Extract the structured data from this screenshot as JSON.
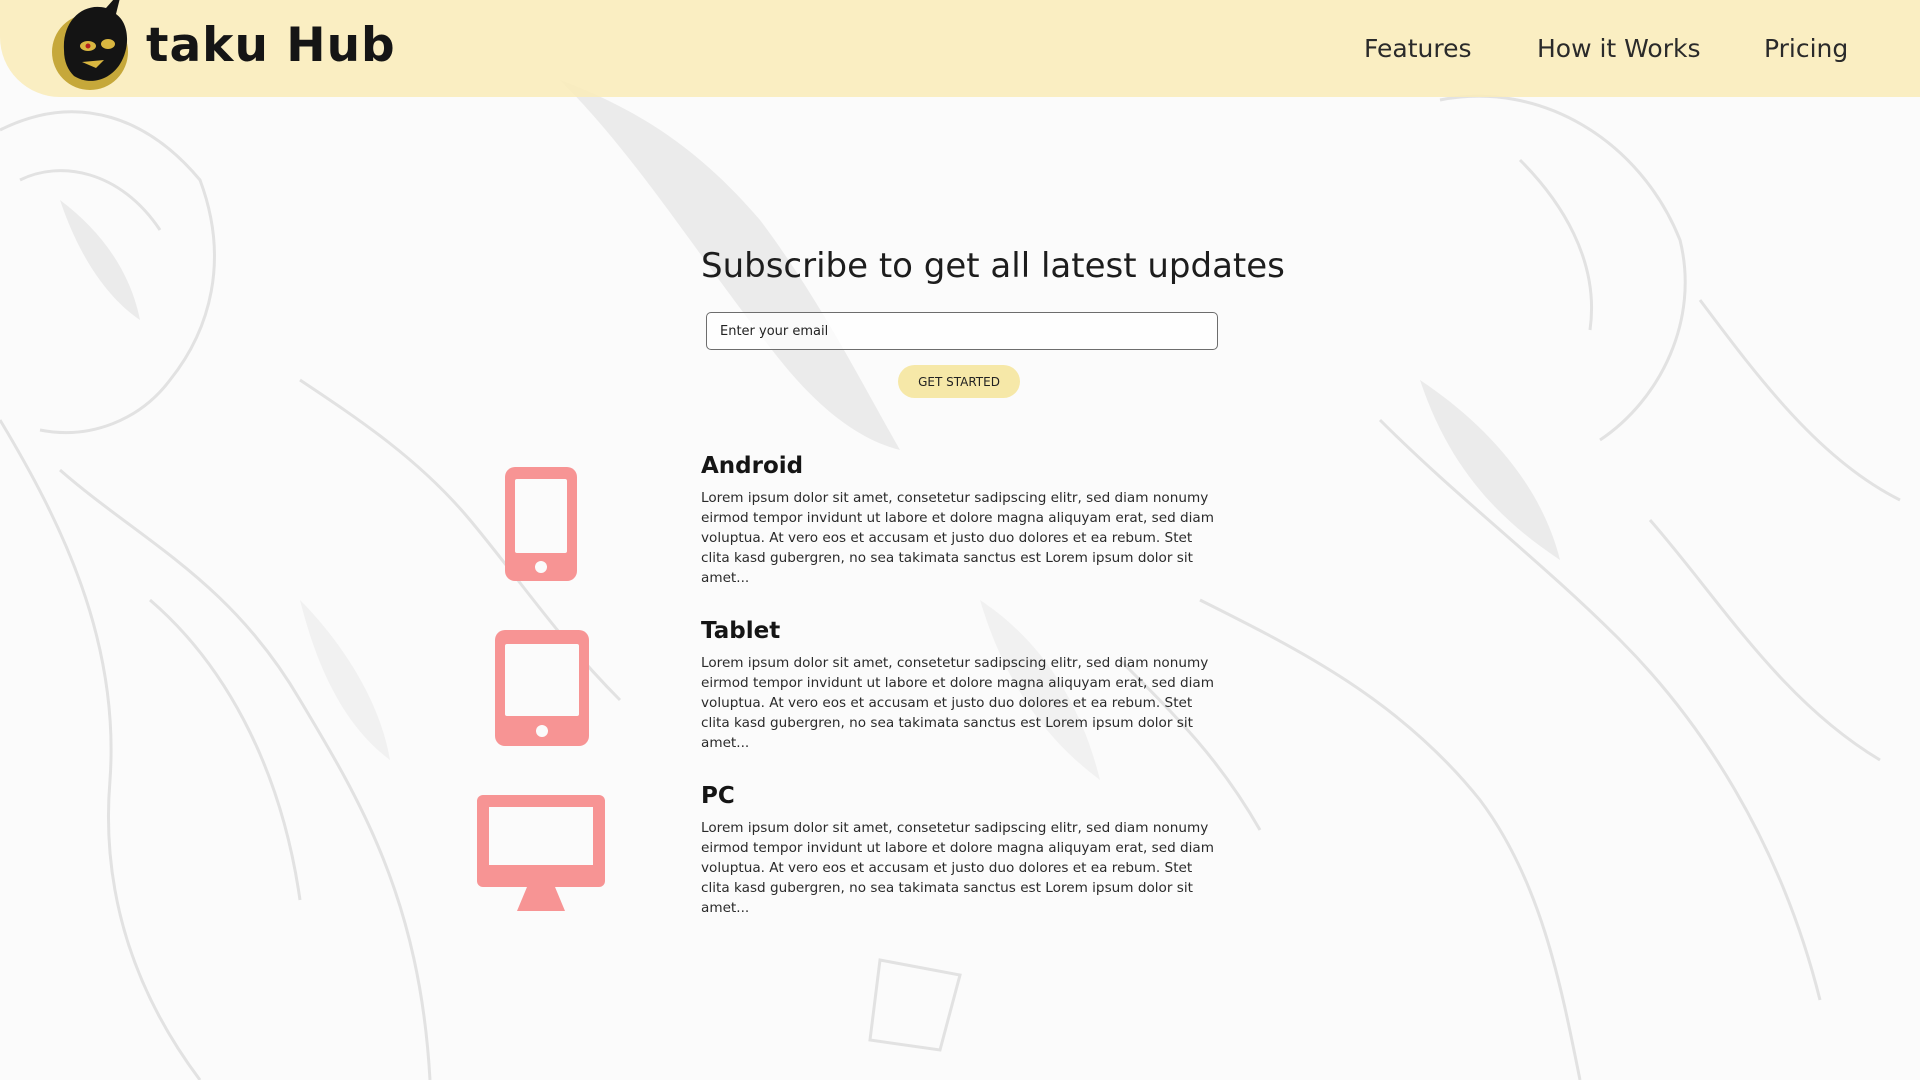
{
  "header": {
    "brand": "taku Hub",
    "nav": [
      "Features",
      "How it Works",
      "Pricing"
    ]
  },
  "subscribe": {
    "title": "Subscribe to get all latest updates",
    "email_placeholder": "Enter your email",
    "cta_label": "GET STARTED"
  },
  "features": [
    {
      "icon": "phone-icon",
      "title": "Android",
      "description": "Lorem ipsum dolor sit amet, consetetur sadipscing elitr, sed diam nonumy eirmod tempor invidunt ut labore et dolore magna aliquyam erat, sed diam voluptua. At vero eos et accusam et justo duo dolores et ea rebum. Stet clita kasd gubergren, no sea takimata sanctus est Lorem ipsum dolor sit amet..."
    },
    {
      "icon": "tablet-icon",
      "title": "Tablet",
      "description": "Lorem ipsum dolor sit amet, consetetur sadipscing elitr, sed diam nonumy eirmod tempor invidunt ut labore et dolore magna aliquyam erat, sed diam voluptua. At vero eos et accusam et justo duo dolores et ea rebum. Stet clita kasd gubergren, no sea takimata sanctus est Lorem ipsum dolor sit amet..."
    },
    {
      "icon": "desktop-icon",
      "title": "PC",
      "description": "Lorem ipsum dolor sit amet, consetetur sadipscing elitr, sed diam nonumy eirmod tempor invidunt ut labore et dolore magna aliquyam erat, sed diam voluptua. At vero eos et accusam et justo duo dolores et ea rebum. Stet clita kasd gubergren, no sea takimata sanctus est Lorem ipsum dolor sit amet..."
    }
  ],
  "colors": {
    "header_bg": "#f9ecb9",
    "accent_button": "#f6e8a8",
    "icon_color": "#f79494",
    "background": "#fbfbfb"
  }
}
